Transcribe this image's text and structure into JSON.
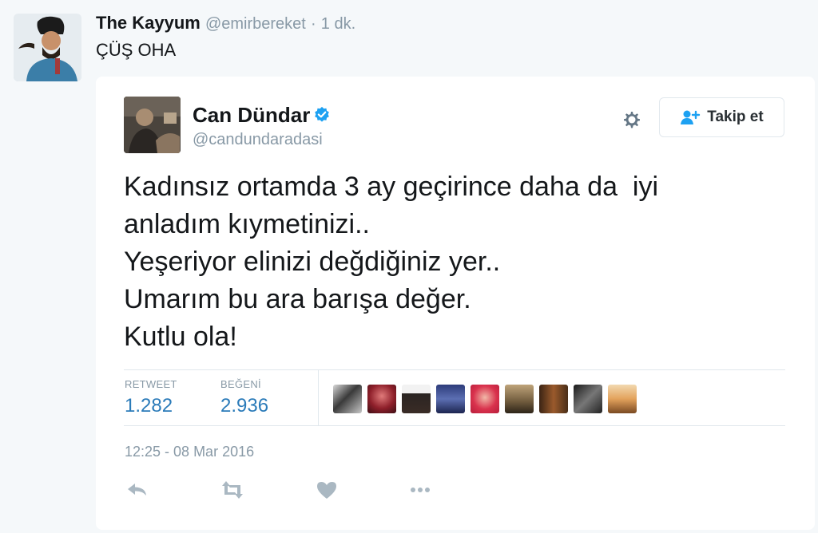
{
  "outer_tweet": {
    "name": "The Kayyum",
    "handle": "@emirbereket",
    "separator": "·",
    "time": "1 dk.",
    "text": "ÇÜŞ OHA"
  },
  "quoted_tweet": {
    "name": "Can Dündar",
    "handle": "@candundaradasi",
    "follow_label": "Takip et",
    "text_lines": [
      "Kadınsız ortamda 3 ay geçirince daha da  iyi",
      "anladım kıymetinizi..",
      "Yeşeriyor elinizi değdiğiniz yer..",
      "Umarım bu ara barışa değer.",
      "Kutlu ola!"
    ],
    "stats": {
      "retweet_label": "RETWEET",
      "retweet_count": "1.282",
      "like_label": "BEĞENİ",
      "like_count": "2.936"
    },
    "timestamp": "12:25 - 08 Mar 2016",
    "liker_avatar_count": 9
  },
  "colors": {
    "page_bg": "#f5f8fa",
    "accent_blue": "#2b7bb9",
    "verified_blue": "#1da1f2",
    "muted_text": "#8899a6",
    "action_icon": "#aab8c2"
  },
  "icons": [
    "verified-icon",
    "gear-icon",
    "follow-user-icon",
    "reply-icon",
    "retweet-icon",
    "like-heart-icon",
    "more-dots-icon"
  ]
}
